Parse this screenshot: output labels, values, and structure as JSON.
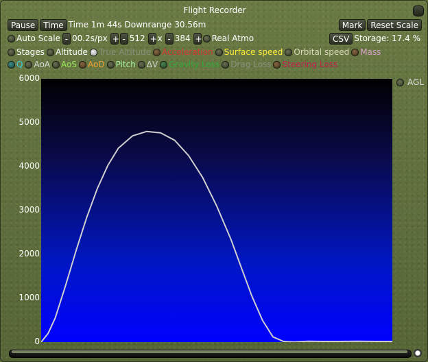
{
  "window": {
    "title": "Flight Recorder"
  },
  "controls": {
    "pause_label": "Pause",
    "time_label": "Time",
    "time_text": "Time 1m 44s",
    "downrange_text": "Downrange 30.56m",
    "mark_label": "Mark",
    "reset_scale_label": "Reset Scale",
    "auto_scale_label": "Auto Scale",
    "minus": "-",
    "plus": "+",
    "time_scale_value": "00.2s/px",
    "width_value": "512",
    "x_sep": "x",
    "height_value": "384",
    "real_atmo_label": "Real Atmo",
    "csv_label": "CSV",
    "storage_text": "Storage: 17.4 %"
  },
  "toggles": {
    "row1": [
      {
        "label": "Stages",
        "color": "#ffffff",
        "on": false,
        "dot": "normal"
      },
      {
        "label": "Altitude",
        "color": "#ffffff",
        "on": false,
        "dot": "normal"
      },
      {
        "label": "True Altitude",
        "color": "#8a8f7c",
        "on": true,
        "dot": "normal"
      },
      {
        "label": "Acceleration",
        "color": "#d23a2e",
        "on": false,
        "dot": "brown"
      },
      {
        "label": "Surface speed",
        "color": "#ffeb3b",
        "on": false,
        "dot": "normal"
      },
      {
        "label": "Orbital speed",
        "color": "#d9d9b8",
        "on": false,
        "dot": "normal"
      },
      {
        "label": "Mass",
        "color": "#d8a0c8",
        "on": false,
        "dot": "brown"
      }
    ],
    "row2": [
      {
        "label": "Q",
        "color": "#38d0e0",
        "on": false,
        "dot": "teal"
      },
      {
        "label": "AoA",
        "color": "#d8d8d8",
        "on": false,
        "dot": "normal"
      },
      {
        "label": "AoS",
        "color": "#9ae85a",
        "on": false,
        "dot": "normal"
      },
      {
        "label": "AoD",
        "color": "#f0a030",
        "on": false,
        "dot": "brown"
      },
      {
        "label": "Pitch",
        "color": "#a6f0a6",
        "on": false,
        "dot": "normal"
      },
      {
        "label": "ΔV",
        "color": "#d0d0d0",
        "on": false,
        "dot": "normal"
      },
      {
        "label": "Gravity Loss",
        "color": "#2faa3a",
        "on": false,
        "dot": "green"
      },
      {
        "label": "Drag Loss",
        "color": "#8a8f7c",
        "on": false,
        "dot": "normal"
      },
      {
        "label": "Steering Loss",
        "color": "#c0204a",
        "on": false,
        "dot": "brown"
      }
    ]
  },
  "agl_label": "AGL",
  "chart_data": {
    "type": "line",
    "title": "",
    "xlabel": "",
    "ylabel": "",
    "ylim": [
      0,
      6000
    ],
    "yticks": [
      "0",
      "1000",
      "2000",
      "3000",
      "4000",
      "5000",
      "6000"
    ],
    "series": [
      {
        "color": "#cfcfcf",
        "x": [
          0,
          0.02,
          0.04,
          0.07,
          0.1,
          0.13,
          0.16,
          0.19,
          0.22,
          0.26,
          0.3,
          0.34,
          0.38,
          0.42,
          0.46,
          0.5,
          0.54,
          0.57,
          0.6,
          0.63,
          0.66,
          0.69,
          0.72,
          0.76,
          0.8,
          0.85,
          0.9,
          0.95,
          1.0
        ],
        "y": [
          0,
          200,
          550,
          1300,
          2100,
          2850,
          3500,
          4030,
          4420,
          4700,
          4800,
          4770,
          4600,
          4250,
          3750,
          3100,
          2350,
          1700,
          1050,
          500,
          120,
          15,
          5,
          20,
          15,
          15,
          20,
          15,
          15
        ]
      }
    ]
  }
}
